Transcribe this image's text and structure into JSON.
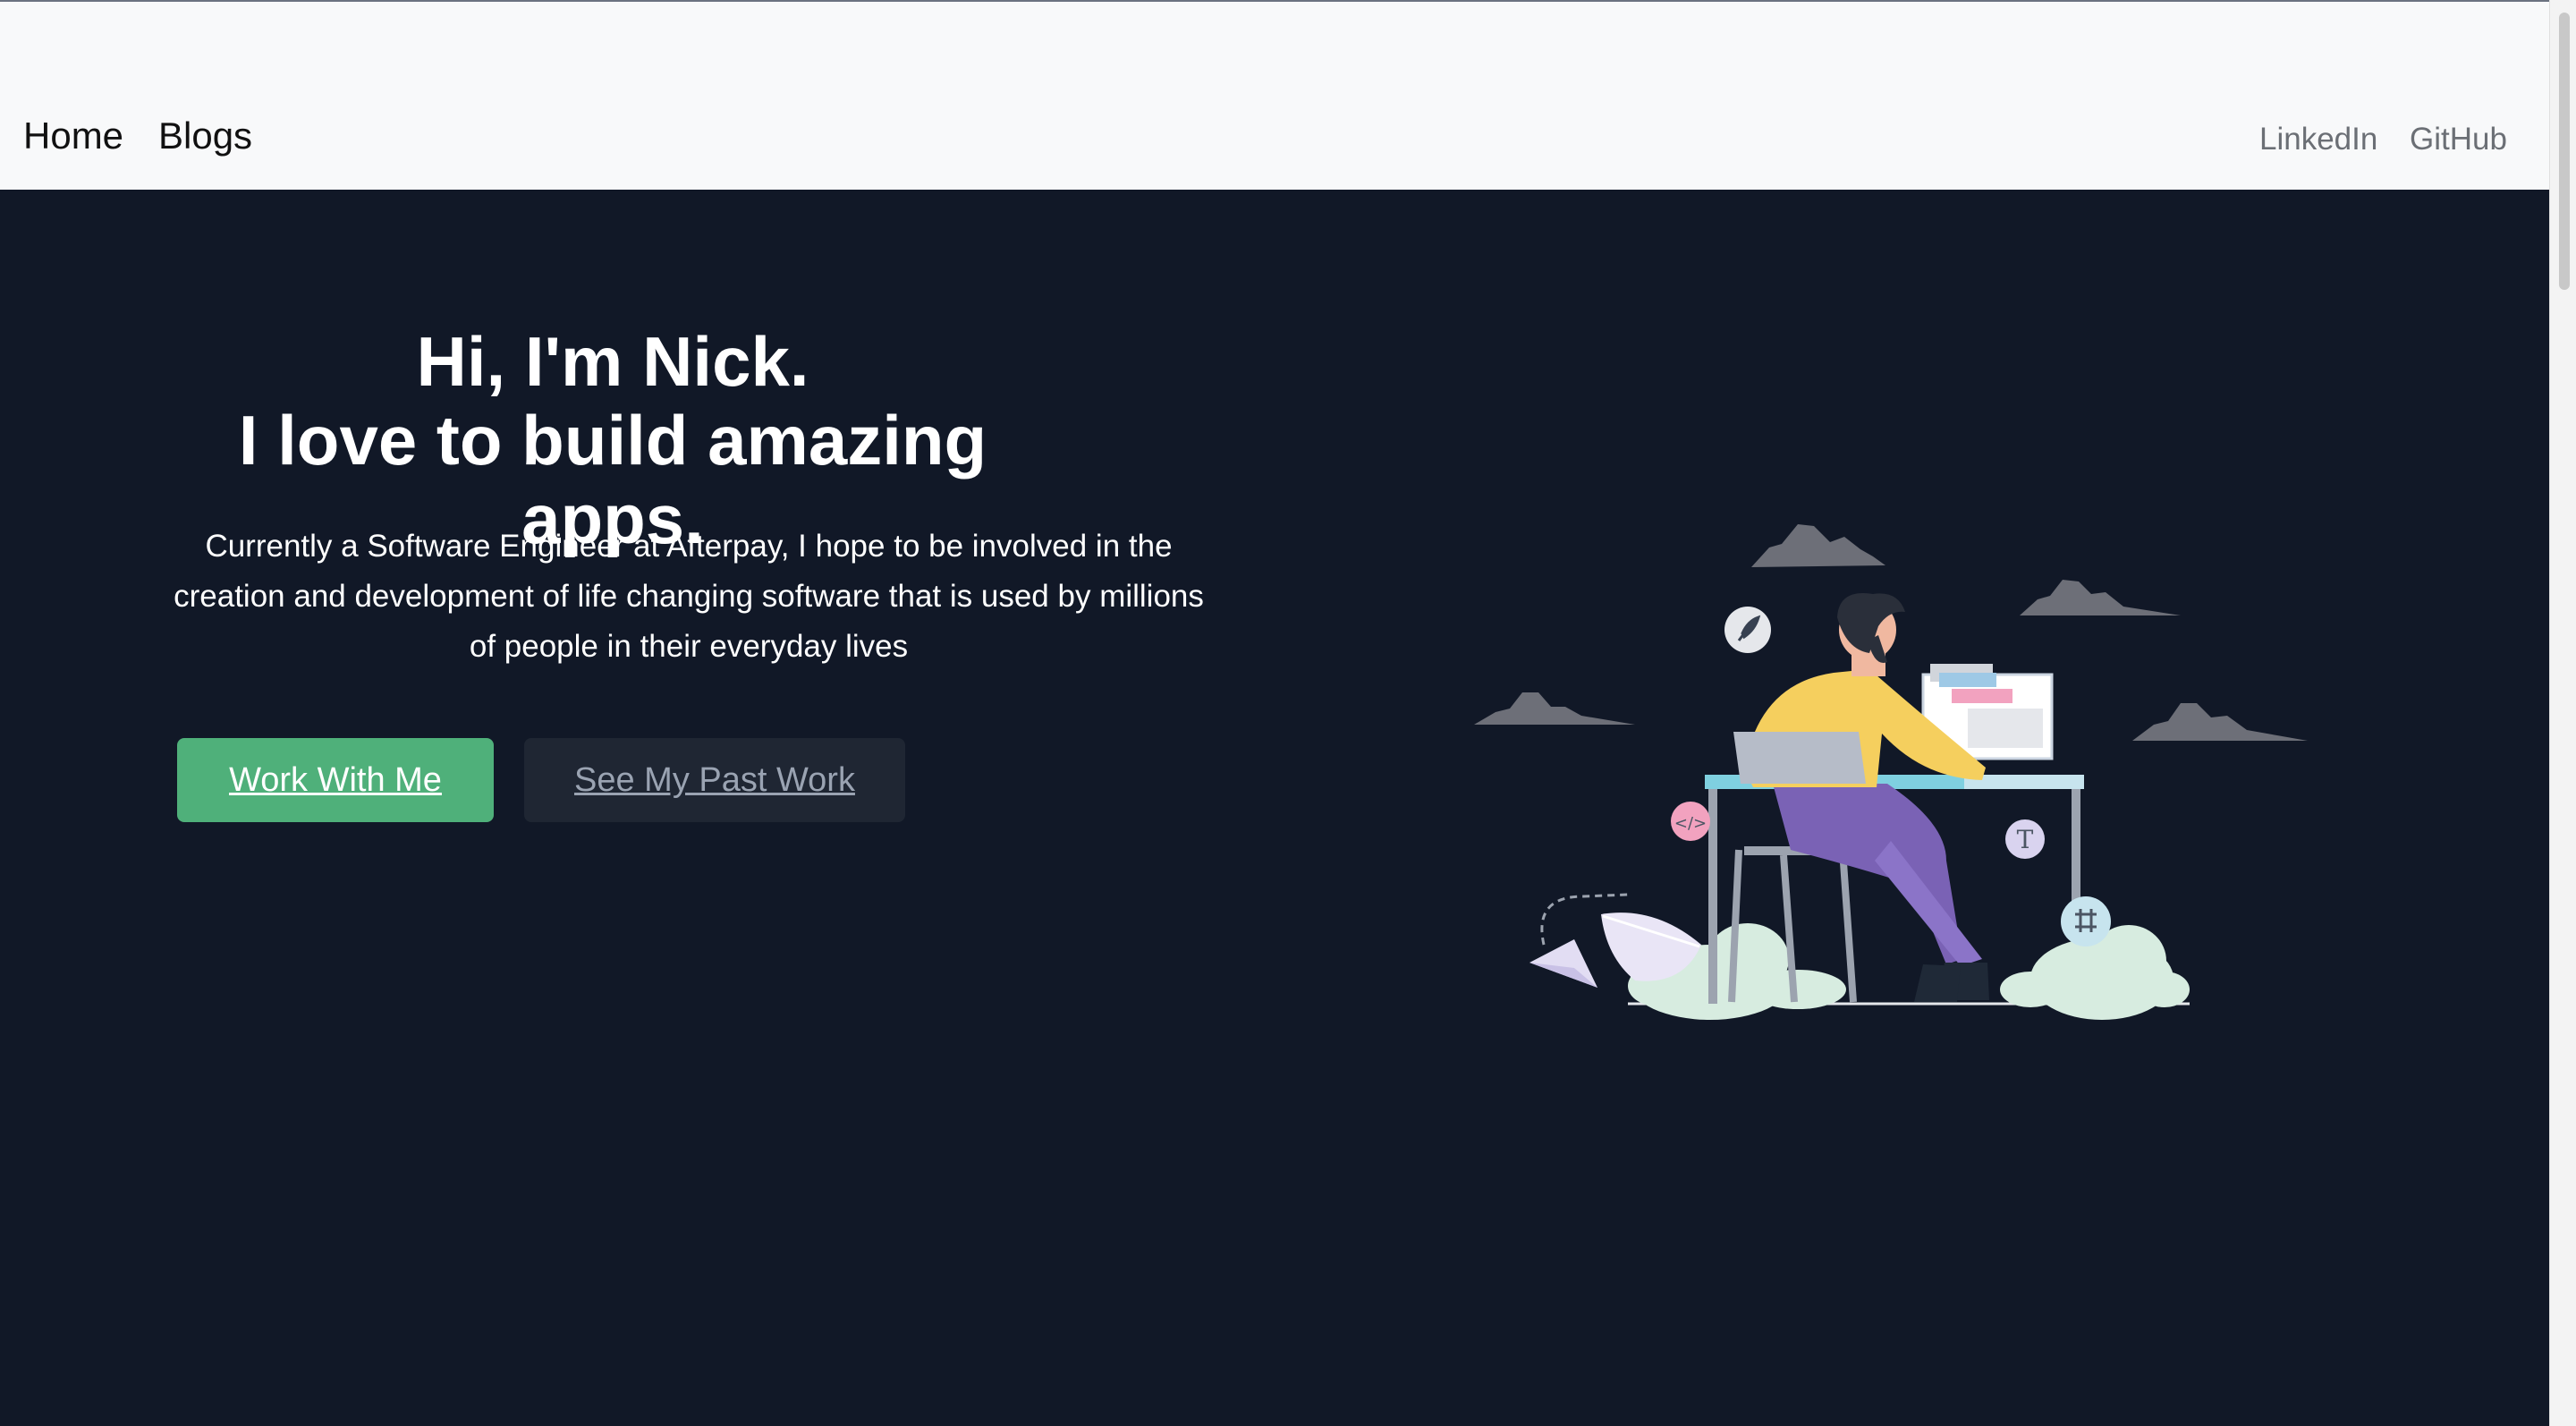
{
  "nav": {
    "home": "Home",
    "blogs": "Blogs",
    "linkedin": "LinkedIn",
    "github": "GitHub"
  },
  "hero": {
    "heading_line1": "Hi, I'm Nick.",
    "heading_line2": "I love to build amazing apps.",
    "subtitle": "Currently a Software Engineer at Afterpay, I hope to be involved in the creation and development of life changing software that is used by millions of people in their everyday lives",
    "primary_button": "Work With Me",
    "secondary_button": "See My Past Work"
  },
  "colors": {
    "background": "#111827",
    "navbar": "#f8f9fa",
    "primary_button": "#4fb07a",
    "secondary_button": "#1f2633",
    "shirt": "#f5cf5e",
    "pants": "#7a62b5",
    "plants": "#d7ece0"
  },
  "illustration": {
    "icons": [
      "feather-icon",
      "code-icon",
      "text-tool-icon",
      "crop-icon",
      "paper-plane-icon"
    ]
  }
}
